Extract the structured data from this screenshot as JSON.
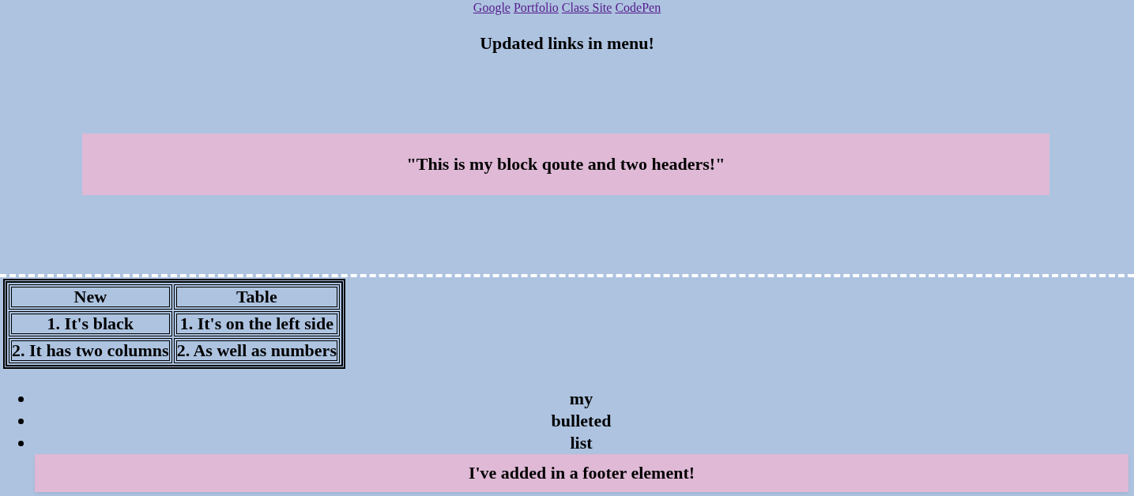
{
  "nav": {
    "links": [
      "Google",
      "Portfolio",
      "Class Site",
      "CodePen"
    ]
  },
  "heading": "Updated links in menu!",
  "blockquote": "\"This is my block qoute and two headers!\"",
  "table": {
    "columns": [
      "New",
      "Table"
    ],
    "rows": [
      [
        "1. It's black",
        "1. It's on the left side"
      ],
      [
        "2. It has two columns",
        "2. As well as numbers"
      ]
    ]
  },
  "list": [
    "my",
    "bulleted",
    "list"
  ],
  "footer": "I've added in a footer element!"
}
